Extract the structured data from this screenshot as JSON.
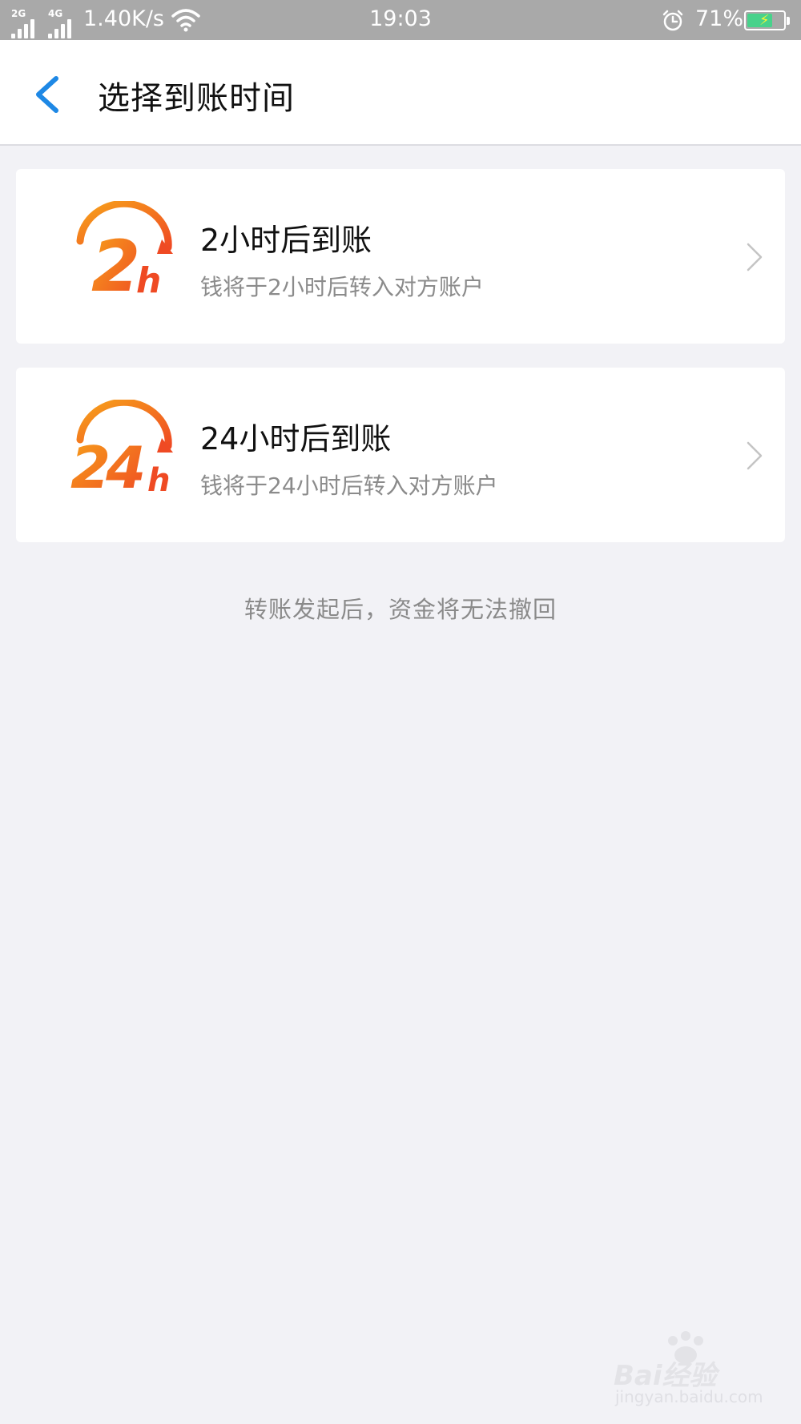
{
  "status_bar": {
    "network1": "2G",
    "network2": "4G",
    "speed": "1.40K/s",
    "time": "19:03",
    "battery_percent": "71%",
    "battery_level": 0.71,
    "icons": [
      "signal-icon",
      "wifi-icon",
      "alarm-icon",
      "battery-icon"
    ]
  },
  "header": {
    "title": "选择到账时间",
    "back_icon": "chevron-left-icon",
    "accent_color": "#1e88e5"
  },
  "options": [
    {
      "logo_text": "2h",
      "title": "2小时后到账",
      "subtitle": "钱将于2小时后转入对方账户"
    },
    {
      "logo_text": "24h",
      "title": "24小时后到账",
      "subtitle": "钱将于24小时后转入对方账户"
    }
  ],
  "notice": "转账发起后，资金将无法撤回",
  "watermark": {
    "main": "Bai经验",
    "sub": "jingyan.baidu.com"
  },
  "colors": {
    "logo_orange": "#f26522",
    "logo_yellow": "#f7a21b",
    "background": "#f2f2f6"
  }
}
